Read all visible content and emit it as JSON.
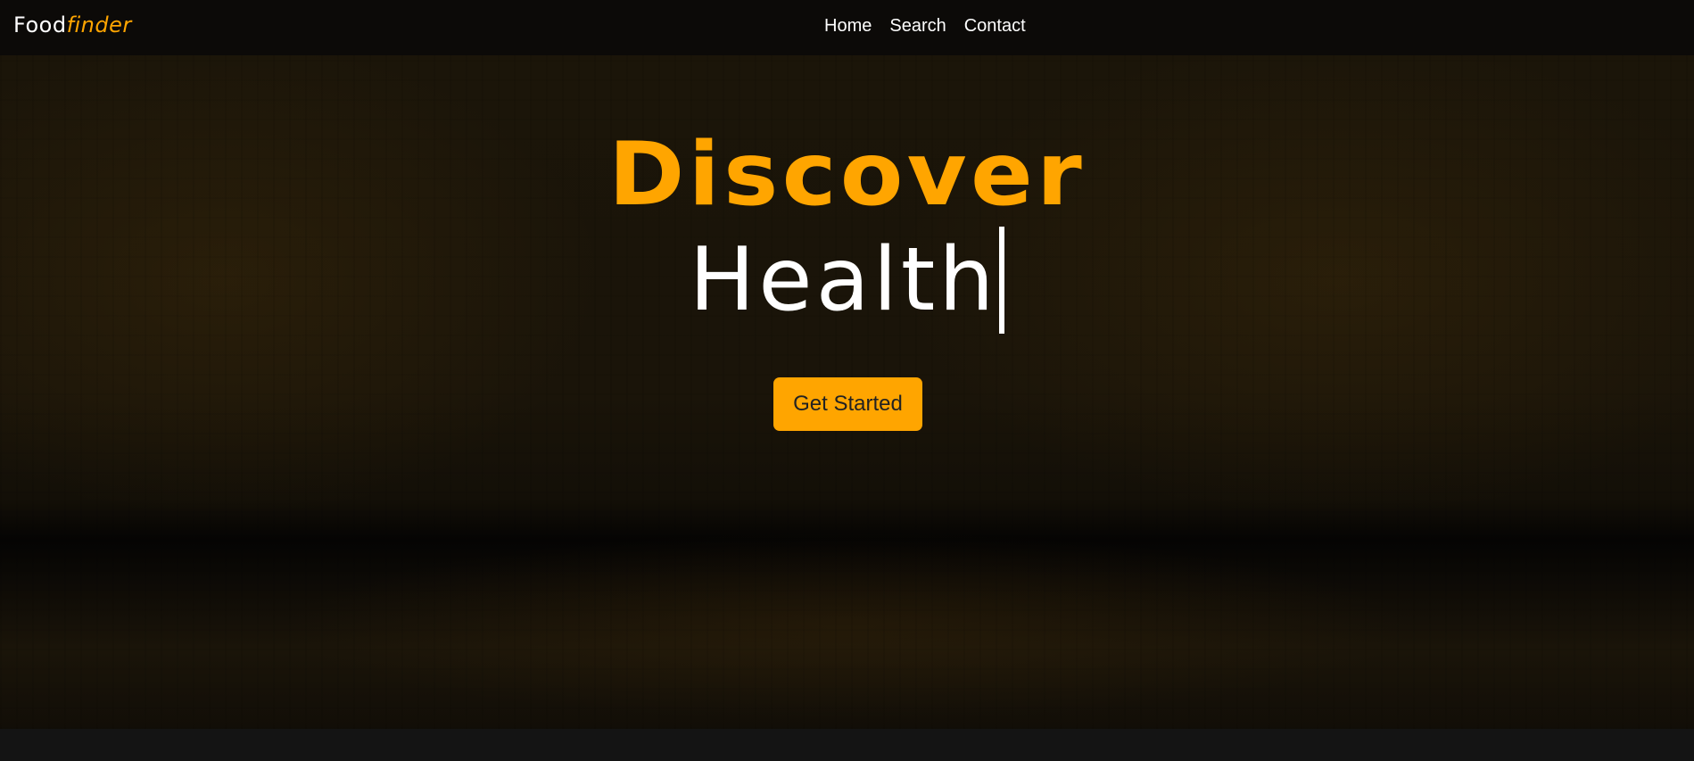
{
  "brand": {
    "part1": "Food",
    "part2": "finder"
  },
  "nav": {
    "links": [
      "Home",
      "Search",
      "Contact"
    ]
  },
  "hero": {
    "headline_1": "Discover",
    "headline_2": "Health",
    "cta_label": "Get Started"
  },
  "colors": {
    "accent": "#ffa500",
    "text": "#ffffff",
    "navbar_bg": "#0c0a08",
    "footer_bg": "#141414"
  }
}
